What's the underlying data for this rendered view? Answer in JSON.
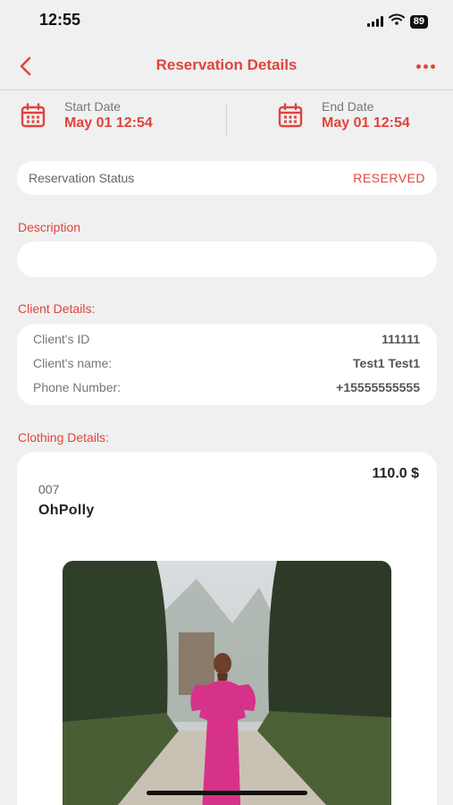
{
  "status_bar": {
    "time": "12:55",
    "battery": "89"
  },
  "header": {
    "title": "Reservation Details"
  },
  "dates": {
    "start_label": "Start Date",
    "start_value": "May 01 12:54",
    "end_label": "End Date",
    "end_value": "May 01 12:54"
  },
  "reservation_status": {
    "label": "Reservation Status",
    "value": "RESERVED"
  },
  "description": {
    "label": "Description",
    "value": ""
  },
  "client": {
    "section_label": "Client Details:",
    "rows": [
      {
        "label": "Client's ID",
        "value": "111111"
      },
      {
        "label": "Client's name:",
        "value": "Test1 Test1"
      },
      {
        "label": "Phone Number:",
        "value": "+15555555555"
      }
    ]
  },
  "clothing": {
    "section_label": "Clothing Details:",
    "price": "110.0 $",
    "code": "007",
    "name": "OhPolly"
  },
  "colors": {
    "accent": "#e0443c",
    "background": "#f0f0f0",
    "card": "#ffffff"
  }
}
